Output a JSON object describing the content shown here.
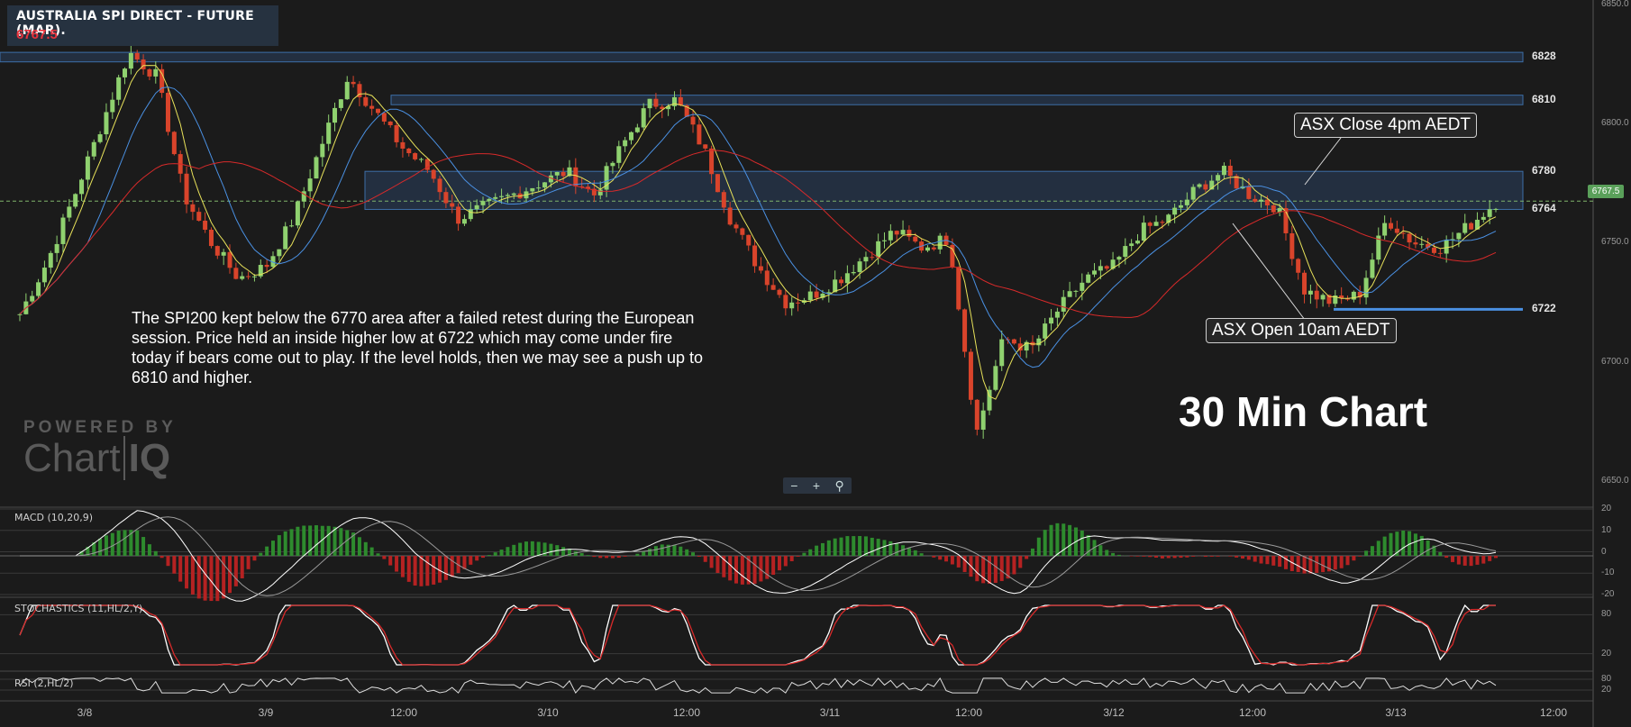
{
  "header": {
    "title": "AUSTRALIA SPI DIRECT - FUTURE (MAR).",
    "last_price": "6767.5"
  },
  "annotation": {
    "commentary": "The SPI200 kept below the 6770 area after a failed retest during the European session. Price held an inside higher low at 6722 which may come under fire today if bears come out to play. If the level holds, then we may see a push up to 6810 and higher.",
    "chart_label": "30 Min Chart",
    "asx_close": "ASX Close 4pm AEDT",
    "asx_open": "ASX Open 10am AEDT"
  },
  "branding": {
    "powered_by": "POWERED BY",
    "name": "Chart",
    "name_suffix": "IQ"
  },
  "indicators": {
    "macd": "MACD (10,20,9)",
    "stochastics": "STOCHASTICS (11,HL/2,Y)",
    "rsi": "RSI (2,HL/2)"
  },
  "colors": {
    "up": "#8fd16f",
    "down": "#d9442b",
    "level_band": "#2f4a6e",
    "ma_fast": "#e8e25a",
    "ma_mid": "#4a90e2",
    "ma_slow": "#d82a2a"
  },
  "chart_data": [
    {
      "type": "candlestick",
      "title": "AUSTRALIA SPI DIRECT - FUTURE (MAR).",
      "last": 6767.5,
      "x_ticks": [
        "3/8",
        "3/9",
        "12:00",
        "3/10",
        "12:00",
        "3/11",
        "12:00",
        "3/12",
        "12:00",
        "3/13",
        "12:00"
      ],
      "y_ticks": [
        "6850.0",
        "6800.0",
        "6750.0",
        "6700.0",
        "6650.0"
      ],
      "ylim": [
        6640,
        6852
      ],
      "levels": [
        {
          "label": "6828",
          "low": 6826,
          "high": 6830
        },
        {
          "label": "6810",
          "low": 6808,
          "high": 6812
        },
        {
          "label": "6780",
          "low": 6764,
          "high": 6780
        },
        {
          "label": "6764",
          "value": 6764
        },
        {
          "label": "6722",
          "value": 6722
        }
      ],
      "approx_path": [
        6720,
        6742,
        6770,
        6800,
        6830,
        6820,
        6770,
        6750,
        6735,
        6740,
        6760,
        6790,
        6820,
        6805,
        6790,
        6780,
        6760,
        6765,
        6770,
        6775,
        6780,
        6770,
        6790,
        6808,
        6810,
        6790,
        6760,
        6740,
        6725,
        6728,
        6735,
        6745,
        6755,
        6748,
        6752,
        6670,
        6710,
        6705,
        6722,
        6735,
        6740,
        6755,
        6760,
        6772,
        6780,
        6770,
        6765,
        6730,
        6725,
        6728,
        6760,
        6750,
        6748,
        6757,
        6767
      ]
    },
    {
      "type": "line",
      "title": "MACD (10,20,9)",
      "y_ticks": [
        "20",
        "10",
        "0",
        "-10",
        "-20"
      ],
      "ylim": [
        -20,
        20
      ]
    },
    {
      "type": "line",
      "title": "STOCHASTICS (11,HL/2,Y)",
      "y_ticks": [
        "80",
        "20"
      ],
      "ylim": [
        0,
        100
      ]
    },
    {
      "type": "line",
      "title": "RSI (2,HL/2)",
      "y_ticks": [
        "80",
        "20"
      ],
      "ylim": [
        0,
        100
      ]
    }
  ]
}
